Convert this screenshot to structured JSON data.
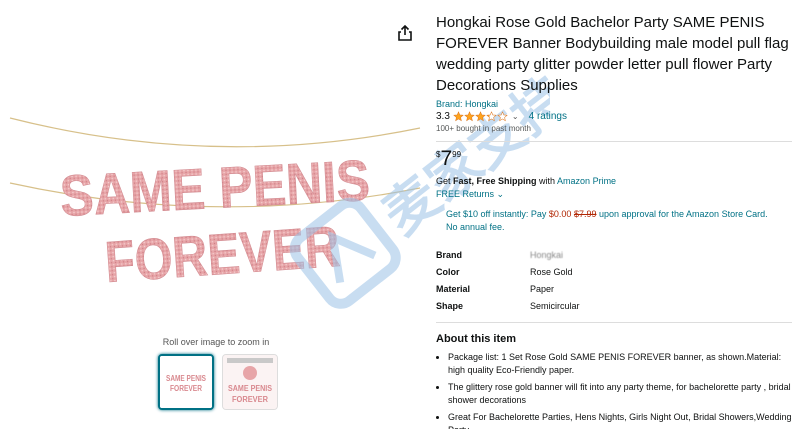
{
  "product": {
    "title": "Hongkai Rose Gold Bachelor Party SAME PENIS FOREVER Banner Bodybuilding male model pull flag wedding party glitter powder letter pull flower Party Decorations Supplies",
    "brand_link": "Brand: Hongkai",
    "rating_value": "3.3",
    "rating_stars": 3.3,
    "ratings_count": "4 ratings",
    "bought": "100+ bought in past month"
  },
  "price": {
    "symbol": "$",
    "whole": "7",
    "fraction": "99"
  },
  "shipping": {
    "prefix": "Get ",
    "bold": "Fast, Free Shipping",
    "middle": " with ",
    "prime": "Amazon Prime",
    "returns": "FREE Returns",
    "returns_chevron": "⌄"
  },
  "promo": {
    "part1": "Get $10 off instantly: Pay ",
    "zero": "$0.00",
    "strike": "$7.99",
    "part2": " upon approval for the Amazon Store Card. No annual fee."
  },
  "specs": [
    {
      "key": "Brand",
      "value": "Hongkai"
    },
    {
      "key": "Color",
      "value": "Rose Gold"
    },
    {
      "key": "Material",
      "value": "Paper"
    },
    {
      "key": "Shape",
      "value": "Semicircular"
    }
  ],
  "about": {
    "heading": "About this item",
    "bullets": [
      "Package list: 1 Set Rose Gold SAME PENIS FOREVER banner, as shown.Material: high quality Eco-Friendly paper.",
      "The glittery rose gold banner will fit into any party theme, for bachelorette party , bridal shower decorations",
      "Great For Bachelorette Parties, Hens Nights, Girls Night Out, Bridal Showers,Wedding Party"
    ]
  },
  "media": {
    "banner_line1": "SAME PENIS",
    "banner_line2": "FOREVER",
    "zoom_hint": "Roll over image to zoom in",
    "thumb1_line1": "SAME PENIS",
    "thumb1_line2": "FOREVER",
    "thumb2_line1": "SAME PENIS",
    "thumb2_line2": "FOREVER",
    "share_icon": "share-icon"
  },
  "watermark": {
    "text": "麦家支持"
  },
  "colors": {
    "link": "#007185",
    "price_red": "#b12704",
    "star": "#ffa41c",
    "banner_pink": "#e8a2a6",
    "watermark_blue": "#9cc2e6"
  }
}
